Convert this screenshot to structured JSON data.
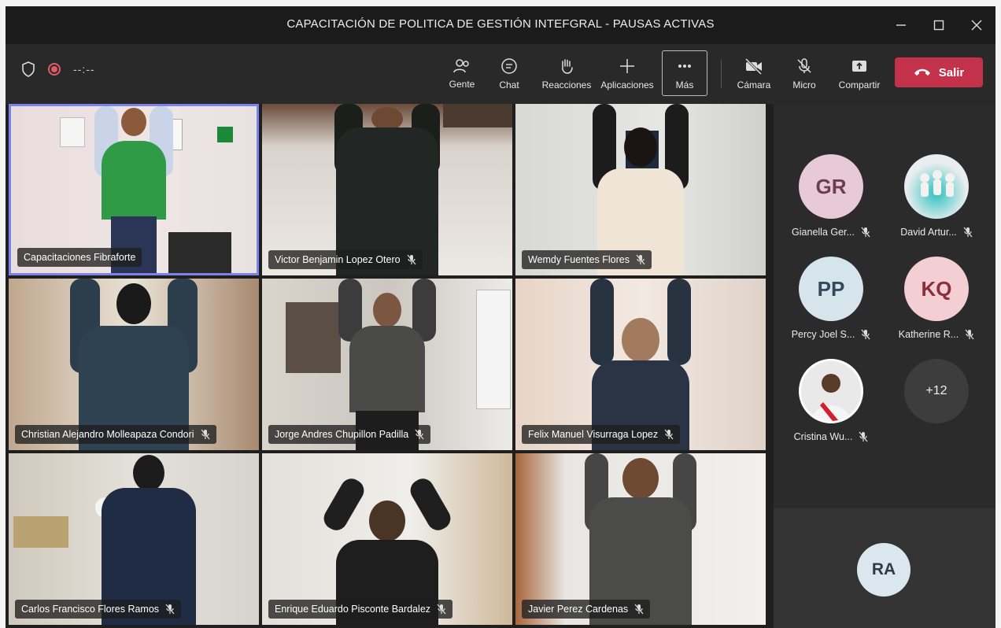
{
  "window": {
    "title": "CAPACITACIÓN DE POLITICA DE GESTIÓN INTEFGRAL - PAUSAS ACTIVAS"
  },
  "toolbar": {
    "timer": "--:--",
    "buttons": [
      {
        "label": "Gente",
        "icon": "people-icon"
      },
      {
        "label": "Chat",
        "icon": "chat-icon"
      },
      {
        "label": "Reacciones",
        "icon": "raise-hand-icon"
      },
      {
        "label": "Aplicaciones",
        "icon": "plus-icon"
      },
      {
        "label": "Más",
        "icon": "more-icon"
      },
      {
        "label": "Cámara",
        "icon": "camera-off-icon"
      },
      {
        "label": "Micro",
        "icon": "mic-off-icon"
      },
      {
        "label": "Compartir",
        "icon": "share-icon"
      }
    ],
    "leave_label": "Salir",
    "leave_color": "#c4314b"
  },
  "participants_grid": [
    {
      "name": "Capacitaciones Fibraforte",
      "muted": false,
      "active": true
    },
    {
      "name": "Victor Benjamin Lopez Otero",
      "muted": true
    },
    {
      "name": "Wemdy Fuentes Flores",
      "muted": true
    },
    {
      "name": "Christian Alejandro Molleapaza Condori",
      "muted": true
    },
    {
      "name": "Jorge Andres Chupillon Padilla",
      "muted": true
    },
    {
      "name": "Felix Manuel Visurraga Lopez",
      "muted": true
    },
    {
      "name": "Carlos Francisco Flores Ramos",
      "muted": true
    },
    {
      "name": "Enrique Eduardo Pisconte Bardalez",
      "muted": true
    },
    {
      "name": "Javier Perez Cardenas",
      "muted": true
    }
  ],
  "side_participants": [
    {
      "initials": "GR",
      "name": "Gianella Ger...",
      "color": "#e8c9d6"
    },
    {
      "initials": "",
      "name": "David Artur...",
      "color": "#dfe6ea",
      "photo": true
    },
    {
      "initials": "PP",
      "name": "Percy Joel S...",
      "color": "#d6e4ec"
    },
    {
      "initials": "KQ",
      "name": "Katherine R...",
      "color": "#f3cfd3"
    },
    {
      "initials": "",
      "name": "Cristina Wu...",
      "color": "#f2f2f2",
      "photo": true
    }
  ],
  "overflow_count": "+12",
  "spotlight_avatar": {
    "initials": "RA"
  }
}
